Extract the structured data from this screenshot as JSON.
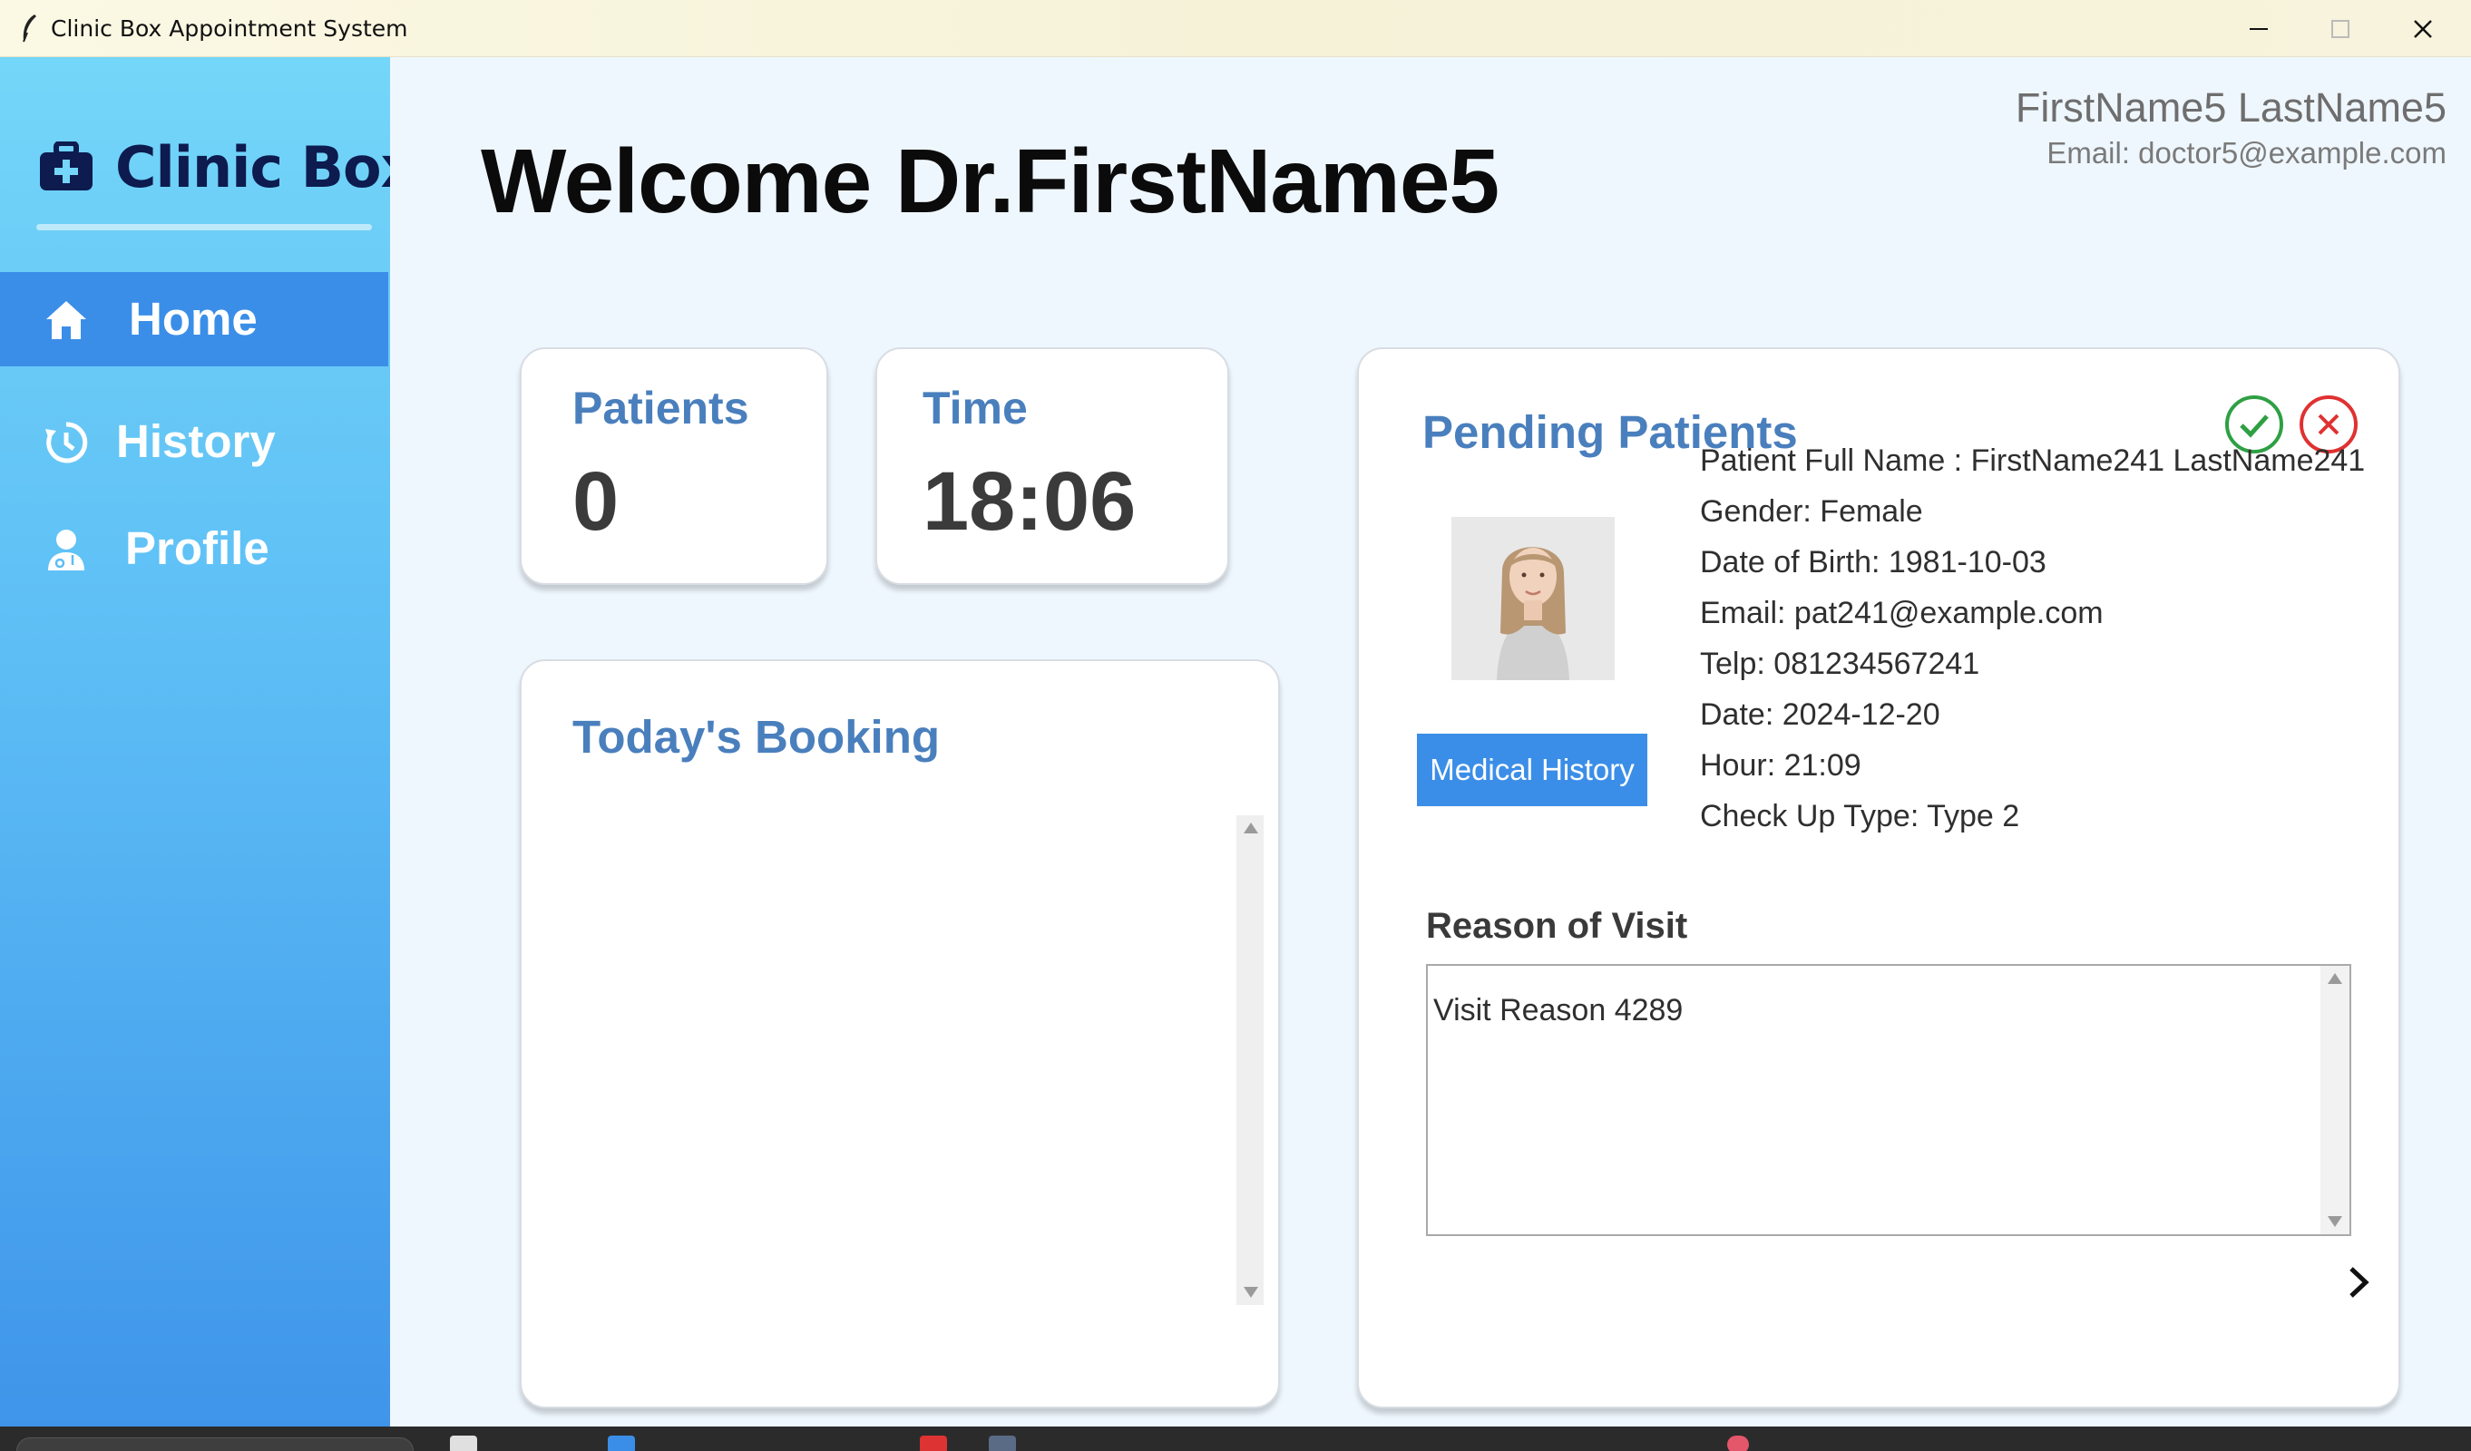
{
  "window": {
    "title": "Clinic Box Appointment System",
    "icons": {
      "app": "feather-icon",
      "minimize": "minimize-icon",
      "maximize": "maximize-icon",
      "close": "close-icon"
    }
  },
  "sidebar": {
    "logo_text": "Clinic Box",
    "logo_icon": "medical-kit-icon",
    "items": [
      {
        "label": "Home",
        "icon": "home-icon",
        "active": true
      },
      {
        "label": "History",
        "icon": "history-icon",
        "active": false
      },
      {
        "label": "Profile",
        "icon": "doctor-icon",
        "active": false
      }
    ]
  },
  "header": {
    "welcome": "Welcome Dr.FirstName5",
    "user_name": "FirstName5 LastName5",
    "user_email": "Email: doctor5@example.com"
  },
  "stats": {
    "patients_label": "Patients",
    "patients_value": "0",
    "time_label": "Time",
    "time_value": "18:06"
  },
  "booking": {
    "title": "Today's Booking"
  },
  "pending": {
    "title": "Pending Patients",
    "accept_icon": "check-circle-icon",
    "reject_icon": "x-circle-icon",
    "medical_history_label": "Medical History",
    "full_name": "Patient Full Name : FirstName241 LastName241",
    "gender": "Gender: Female",
    "dob": "Date of Birth: 1981-10-03",
    "email": "Email: pat241@example.com",
    "telp": "Telp: 081234567241",
    "date": "Date: 2024-12-20",
    "hour": "Hour: 21:09",
    "checkup": "Check Up Type: Type 2",
    "reason_title": "Reason of Visit",
    "reason_text": "Visit Reason 4289",
    "next_icon": "chevron-right-icon"
  },
  "colors": {
    "accent": "#3b8ee8",
    "title_blue": "#4a7fbd",
    "logo_navy": "#0d1b4f",
    "accept_green": "#2ea043",
    "reject_red": "#e03131"
  }
}
